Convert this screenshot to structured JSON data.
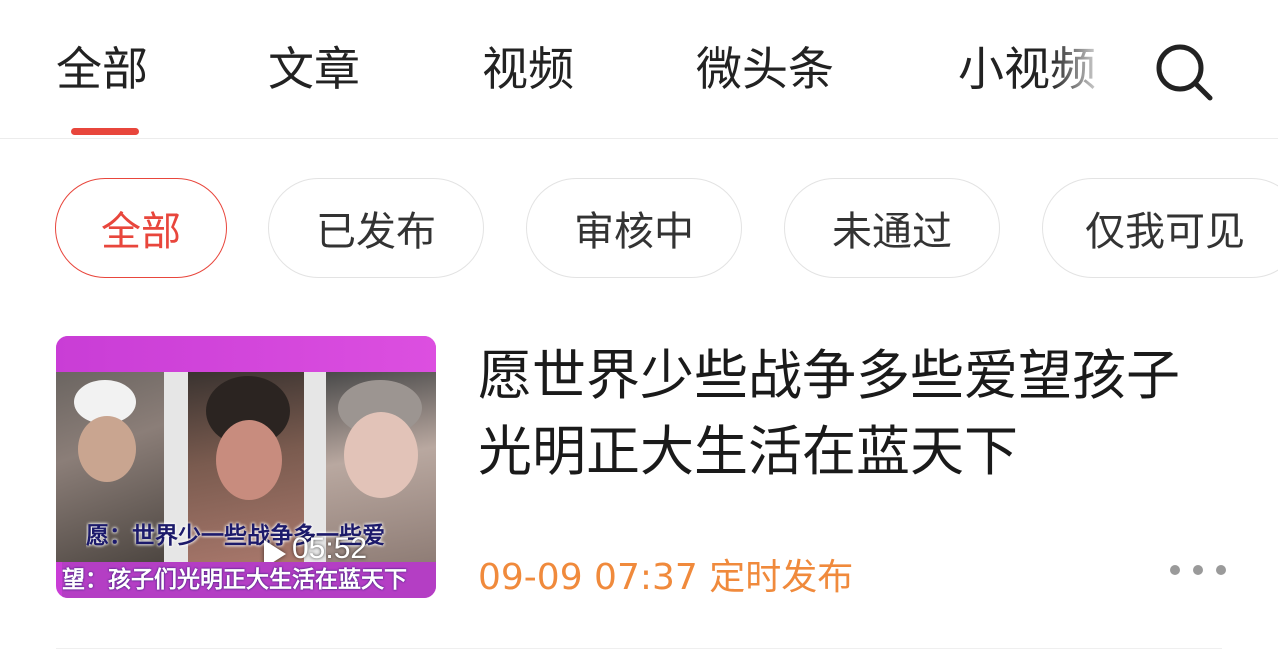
{
  "top_tabs": [
    {
      "label": "全部",
      "active": true
    },
    {
      "label": "文章",
      "active": false
    },
    {
      "label": "视频",
      "active": false
    },
    {
      "label": "微头条",
      "active": false
    },
    {
      "label": "小视频",
      "active": false
    }
  ],
  "search": {
    "icon": "search-icon"
  },
  "filters": [
    {
      "label": "全部",
      "active": true
    },
    {
      "label": "已发布",
      "active": false
    },
    {
      "label": "审核中",
      "active": false
    },
    {
      "label": "未通过",
      "active": false
    },
    {
      "label": "仅我可见",
      "active": false
    }
  ],
  "items": [
    {
      "title": "愿世界少些战争多些爱望孩子光明正大生活在蓝天下",
      "thumbnail": {
        "caption_line1": "愿：世界少一些战争多一些爱",
        "caption_line2": "望：孩子们光明正大生活在蓝天下",
        "duration": "05:52"
      },
      "meta": "09-09 07:37 定时发布",
      "more_icon": "more-dots-icon"
    }
  ],
  "colors": {
    "accent": "#e8463c",
    "meta": "#f08a3c",
    "thumbnail_bg": "#c93dd6"
  }
}
